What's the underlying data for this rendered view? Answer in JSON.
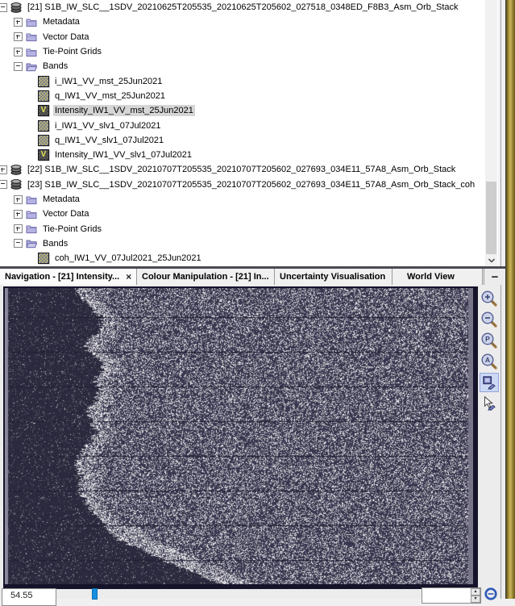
{
  "product_tree": {
    "virtual_band_glyph": "V",
    "rows": [
      {
        "label": "[21] S1B_IW_SLC__1SDV_20210625T205535_20210625T205602_027518_0348ED_F8B3_Asm_Orb_Stack",
        "depth": 0,
        "icon": "product",
        "expander": "minus"
      },
      {
        "label": "Metadata",
        "depth": 1,
        "icon": "folder",
        "expander": "plus"
      },
      {
        "label": "Vector Data",
        "depth": 1,
        "icon": "folder",
        "expander": "plus"
      },
      {
        "label": "Tie-Point Grids",
        "depth": 1,
        "icon": "folder",
        "expander": "plus"
      },
      {
        "label": "Bands",
        "depth": 1,
        "icon": "folder-open",
        "expander": "minus"
      },
      {
        "label": "i_IW1_VV_mst_25Jun2021",
        "depth": 2,
        "icon": "raster"
      },
      {
        "label": "q_IW1_VV_mst_25Jun2021",
        "depth": 2,
        "icon": "raster"
      },
      {
        "label": "Intensity_IW1_VV_mst_25Jun2021",
        "depth": 2,
        "icon": "virtual",
        "selected": true
      },
      {
        "label": "i_IW1_VV_slv1_07Jul2021",
        "depth": 2,
        "icon": "raster"
      },
      {
        "label": "q_IW1_VV_slv1_07Jul2021",
        "depth": 2,
        "icon": "raster"
      },
      {
        "label": "Intensity_IW1_VV_slv1_07Jul2021",
        "depth": 2,
        "icon": "virtual"
      },
      {
        "label": "[22] S1B_IW_SLC__1SDV_20210707T205535_20210707T205602_027693_034E11_57A8_Asm_Orb_Stack",
        "depth": 0,
        "icon": "product",
        "expander": "plus"
      },
      {
        "label": "[23] S1B_IW_SLC__1SDV_20210707T205535_20210707T205602_027693_034E11_57A8_Asm_Orb_Stack_coh",
        "depth": 0,
        "icon": "product",
        "expander": "minus"
      },
      {
        "label": "Metadata",
        "depth": 1,
        "icon": "folder",
        "expander": "plus"
      },
      {
        "label": "Vector Data",
        "depth": 1,
        "icon": "folder",
        "expander": "plus"
      },
      {
        "label": "Tie-Point Grids",
        "depth": 1,
        "icon": "folder",
        "expander": "plus"
      },
      {
        "label": "Bands",
        "depth": 1,
        "icon": "folder-open",
        "expander": "minus"
      },
      {
        "label": "coh_IW1_VV_07Jul2021_25Jun2021",
        "depth": 2,
        "icon": "raster"
      }
    ]
  },
  "tabs": {
    "minimize_glyph": "−",
    "items": [
      {
        "label": "Navigation - [21] Intensity...",
        "close_glyph": "×",
        "active": true
      },
      {
        "label": "Colour Manipulation - [21] In...",
        "active": false
      },
      {
        "label": "Uncertainty Visualisation",
        "active": false
      },
      {
        "label": "World View",
        "active": false
      }
    ]
  },
  "viewer": {
    "tools": [
      {
        "name": "zoom-in",
        "glyph": "+"
      },
      {
        "name": "zoom-out",
        "glyph": "−"
      },
      {
        "name": "zoom-to-pixel",
        "glyph": "P"
      },
      {
        "name": "zoom-all",
        "glyph": "A"
      },
      {
        "name": "rectangle-drawing-tool",
        "selected": true
      },
      {
        "name": "pointer-drawing-tool",
        "selected": false
      }
    ],
    "zoom_field_value": "54.55",
    "colors": {
      "land_base": "#39374f",
      "sea_base": "#2c2a3e",
      "burst_line": "#211f33",
      "edge_strip": "#8a88a0",
      "slider_handle": "#1590e0",
      "gold_strip": "#b59b3e"
    }
  }
}
